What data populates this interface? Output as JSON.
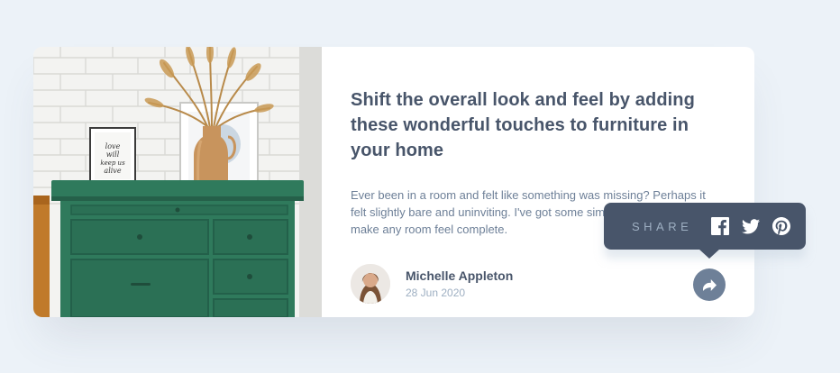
{
  "article": {
    "title": "Shift the overall look and feel by adding these wonderful touches to furniture in your home",
    "description": "Ever been in a room and felt like something was missing? Perhaps it felt slightly bare and uninviting. I've got some simple tips to help you make any room feel complete.",
    "image": {
      "framed_print_text": [
        "love",
        "will",
        "keep us",
        "alive"
      ]
    }
  },
  "author": {
    "name": "Michelle Appleton",
    "date": "28 Jun 2020"
  },
  "share": {
    "label": "SHARE",
    "networks": [
      {
        "name": "facebook",
        "icon": "facebook-icon"
      },
      {
        "name": "twitter",
        "icon": "twitter-icon"
      },
      {
        "name": "pinterest",
        "icon": "pinterest-icon"
      }
    ],
    "button_icon": "share-arrow-icon"
  },
  "colors": {
    "page_bg": "#ecf2f8",
    "card_bg": "#ffffff",
    "title": "#48556a",
    "text": "#6e8098",
    "muted": "#9eafc2",
    "tooltip_bg": "#48556a",
    "dresser_green": "#2f7a5c"
  }
}
